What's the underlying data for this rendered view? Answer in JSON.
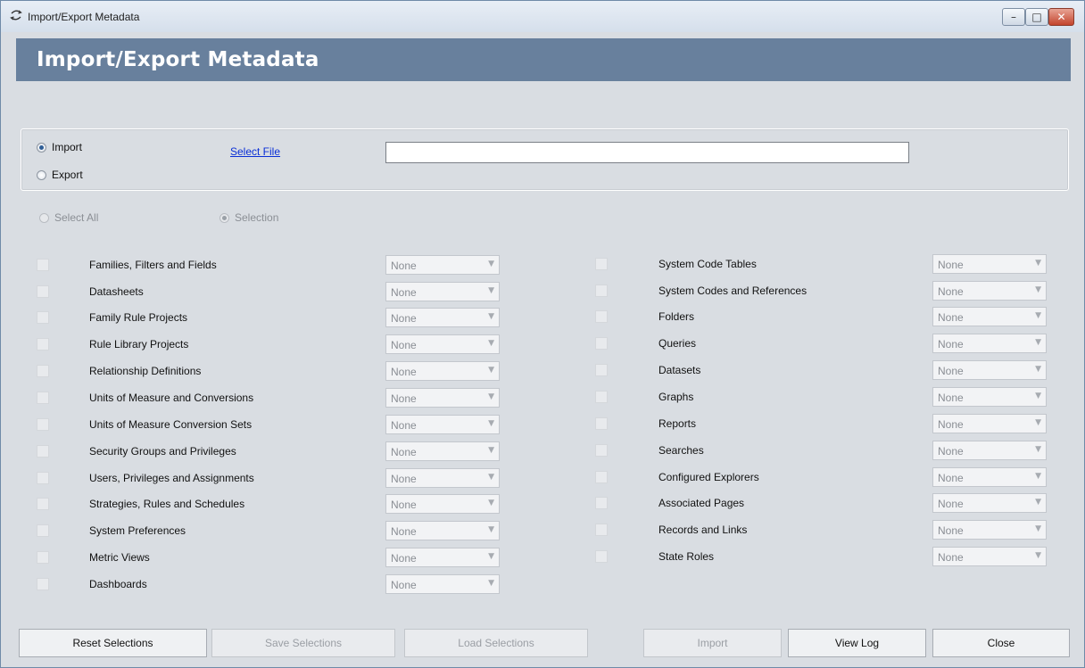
{
  "window": {
    "title": "Import/Export Metadata",
    "icon": "import-export-arrows-icon",
    "controls": {
      "minimize": "–",
      "maximize": "□",
      "close": "✕"
    }
  },
  "banner": {
    "title": "Import/Export Metadata",
    "color": "#68809d"
  },
  "mode": {
    "import_label": "Import",
    "export_label": "Export",
    "selected": "Import"
  },
  "file": {
    "select_link": "Select File",
    "path_value": ""
  },
  "scope": {
    "select_all_label": "Select All",
    "selection_label": "Selection",
    "selected": "Selection"
  },
  "left_items": [
    {
      "label": "Families, Filters and Fields",
      "option": "None"
    },
    {
      "label": "Datasheets",
      "option": "None"
    },
    {
      "label": "Family Rule Projects",
      "option": "None"
    },
    {
      "label": "Rule Library Projects",
      "option": "None"
    },
    {
      "label": "Relationship Definitions",
      "option": "None"
    },
    {
      "label": "Units of Measure and Conversions",
      "option": "None"
    },
    {
      "label": "Units of Measure Conversion Sets",
      "option": "None"
    },
    {
      "label": "Security Groups and Privileges",
      "option": "None"
    },
    {
      "label": "Users, Privileges and Assignments",
      "option": "None"
    },
    {
      "label": "Strategies, Rules and Schedules",
      "option": "None"
    },
    {
      "label": "System Preferences",
      "option": "None"
    },
    {
      "label": "Metric Views",
      "option": "None"
    },
    {
      "label": "Dashboards",
      "option": "None"
    }
  ],
  "right_items": [
    {
      "label": "System Code Tables",
      "option": "None"
    },
    {
      "label": "System Codes and References",
      "option": "None"
    },
    {
      "label": "Folders",
      "option": "None"
    },
    {
      "label": "Queries",
      "option": "None"
    },
    {
      "label": "Datasets",
      "option": "None"
    },
    {
      "label": "Graphs",
      "option": "None"
    },
    {
      "label": "Reports",
      "option": "None"
    },
    {
      "label": "Searches",
      "option": "None"
    },
    {
      "label": "Configured Explorers",
      "option": "None"
    },
    {
      "label": "Associated Pages",
      "option": "None"
    },
    {
      "label": "Records and Links",
      "option": "None"
    },
    {
      "label": "State Roles",
      "option": "None"
    }
  ],
  "buttons": {
    "reset": "Reset Selections",
    "save": "Save Selections",
    "load": "Load Selections",
    "import": "Import",
    "view_log": "View Log",
    "close": "Close"
  }
}
